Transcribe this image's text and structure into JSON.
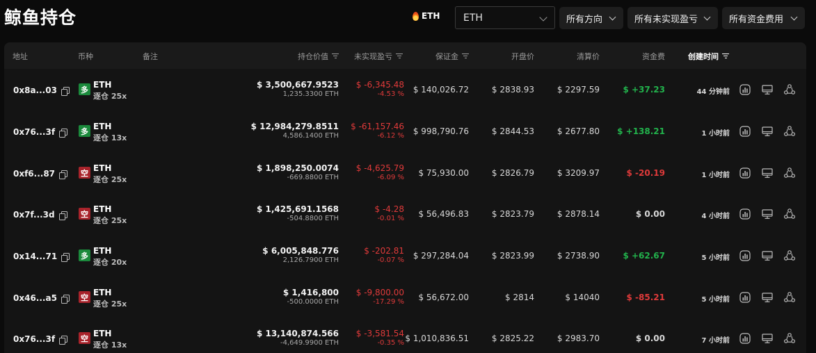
{
  "header": {
    "title": "鲸鱼持仓",
    "token_tag": "ETH",
    "token_select": "ETH",
    "filters": [
      "所有方向",
      "所有未实现盈亏",
      "所有资金费用"
    ]
  },
  "table": {
    "columns": [
      "地址",
      "币种",
      "备注",
      "持仓价值",
      "未实现盈亏",
      "保证金",
      "开盘价",
      "清算价",
      "资金费",
      "创建时间"
    ],
    "rows": [
      {
        "address": "0x8a...03",
        "side": "多",
        "side_type": "long",
        "coin": "ETH",
        "leverage": "逐仓 25x",
        "value": "$ 3,500,667.9523",
        "amount": "1,235.3300 ETH",
        "pnl": "$ -6,345.48",
        "pnl_pct": "-4.53 %",
        "margin": "$ 140,026.72",
        "open": "$ 2838.93",
        "liq": "$ 2297.59",
        "fee": "$ +37.23",
        "fee_type": "pos",
        "time": "44 分钟前"
      },
      {
        "address": "0x76...3f",
        "side": "多",
        "side_type": "long",
        "coin": "ETH",
        "leverage": "逐仓 13x",
        "value": "$ 12,984,279.8511",
        "amount": "4,586.1400 ETH",
        "pnl": "$ -61,157.46",
        "pnl_pct": "-6.12 %",
        "margin": "$ 998,790.76",
        "open": "$ 2844.53",
        "liq": "$ 2677.80",
        "fee": "$ +138.21",
        "fee_type": "pos",
        "time": "1 小时前"
      },
      {
        "address": "0xf6...87",
        "side": "空",
        "side_type": "short",
        "coin": "ETH",
        "leverage": "逐仓 25x",
        "value": "$ 1,898,250.0074",
        "amount": "-669.8800 ETH",
        "pnl": "$ -4,625.79",
        "pnl_pct": "-6.09 %",
        "margin": "$ 75,930.00",
        "open": "$ 2826.79",
        "liq": "$ 3209.97",
        "fee": "$ -20.19",
        "fee_type": "neg",
        "time": "1 小时前"
      },
      {
        "address": "0x7f...3d",
        "side": "空",
        "side_type": "short",
        "coin": "ETH",
        "leverage": "逐仓 25x",
        "value": "$ 1,425,691.1568",
        "amount": "-504.8800 ETH",
        "pnl": "$ -4.28",
        "pnl_pct": "-0.01 %",
        "margin": "$ 56,496.83",
        "open": "$ 2823.79",
        "liq": "$ 2878.14",
        "fee": "$ 0.00",
        "fee_type": "zero",
        "time": "4 小时前"
      },
      {
        "address": "0x14...71",
        "side": "多",
        "side_type": "long",
        "coin": "ETH",
        "leverage": "逐仓 20x",
        "value": "$ 6,005,848.776",
        "amount": "2,126.7900 ETH",
        "pnl": "$ -202.81",
        "pnl_pct": "-0.07 %",
        "margin": "$ 297,284.04",
        "open": "$ 2823.99",
        "liq": "$ 2738.90",
        "fee": "$ +62.67",
        "fee_type": "pos",
        "time": "5 小时前"
      },
      {
        "address": "0x46...a5",
        "side": "空",
        "side_type": "short",
        "coin": "ETH",
        "leverage": "逐仓 25x",
        "value": "$ 1,416,800",
        "amount": "-500.0000 ETH",
        "pnl": "$ -9,800.00",
        "pnl_pct": "-17.29 %",
        "margin": "$ 56,672.00",
        "open": "$ 2814",
        "liq": "$ 14040",
        "fee": "$ -85.21",
        "fee_type": "neg",
        "time": "5 小时前"
      },
      {
        "address": "0x76...3f",
        "side": "空",
        "side_type": "short",
        "coin": "ETH",
        "leverage": "逐仓 13x",
        "value": "$ 13,140,874.566",
        "amount": "-4,649.9900 ETH",
        "pnl": "$ -3,581.54",
        "pnl_pct": "-0.35 %",
        "margin": "$ 1,010,836.51",
        "open": "$ 2825.22",
        "liq": "$ 2983.70",
        "fee": "$ 0.00",
        "fee_type": "zero",
        "time": "7 小时前"
      }
    ]
  },
  "colors": {
    "long": "#1b8a3c",
    "short": "#a8232b",
    "positive": "#22b24c",
    "negative": "#e03a3a"
  },
  "row_icons": [
    "bar-chart-icon",
    "monitor-icon",
    "share-icon"
  ]
}
